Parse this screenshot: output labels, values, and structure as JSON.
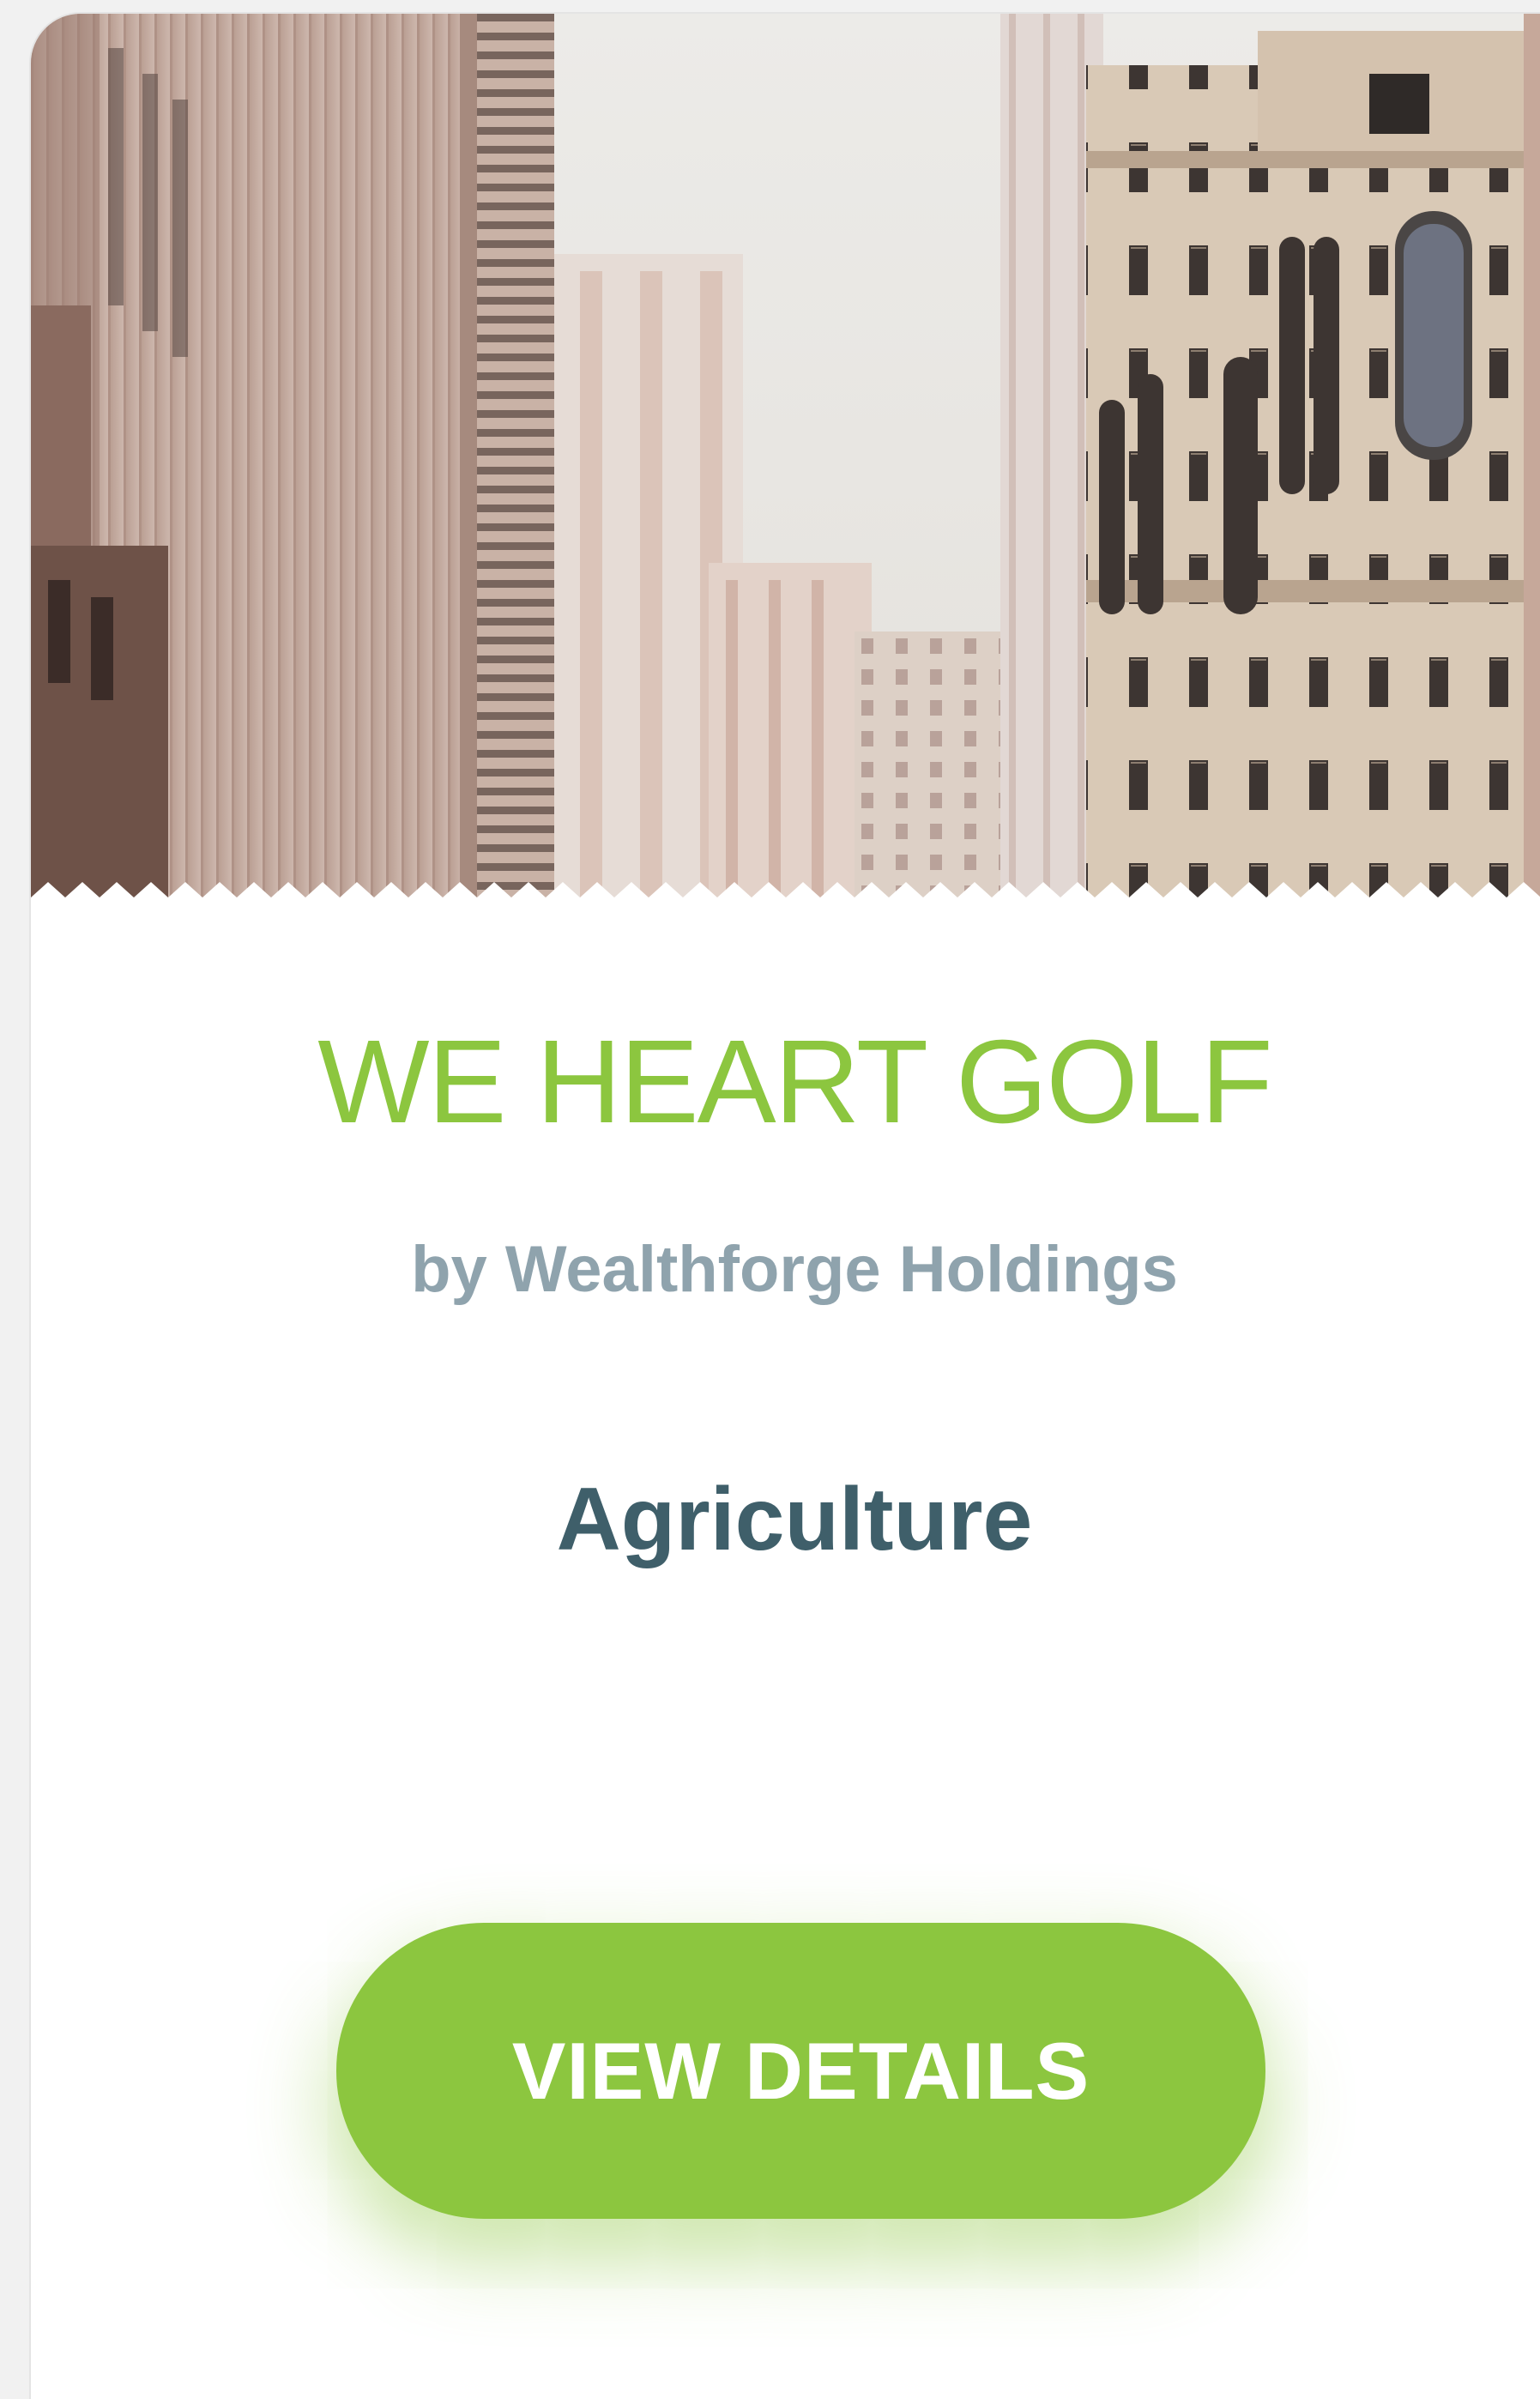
{
  "card": {
    "title": "WE HEART GOLF",
    "subtitle": "by Wealthforge Holdings",
    "category": "Agriculture",
    "button_label": "VIEW DETAILS"
  },
  "colors": {
    "accent": "#8cc63f",
    "subtitle": "#8fa3ad",
    "category": "#3f5f6a"
  }
}
